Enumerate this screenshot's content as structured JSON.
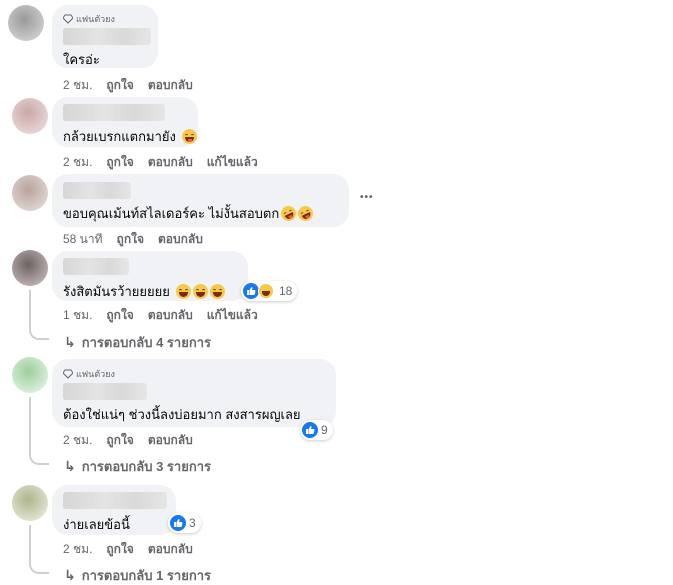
{
  "comments": [
    {
      "badge": "แฟนตัวยง",
      "text": "ใครอ่ะ",
      "meta": {
        "time": "2 ชม.",
        "like": "ถูกใจ",
        "reply": "ตอบกลับ",
        "edited": ""
      },
      "avatar_color": "#b9b9b9"
    },
    {
      "badge": "",
      "text": "กล้วยเบรกแตกมายัง",
      "emojis": [
        "tongue"
      ],
      "meta": {
        "time": "2 ชม.",
        "like": "ถูกใจ",
        "reply": "ตอบกลับ",
        "edited": "แก้ไขแล้ว"
      },
      "avatar_color": "#d9b8b8"
    },
    {
      "badge": "",
      "text": "ขอบคุณเม้นท์สไลเดอร์คะ ไม่งั้นสอบตก",
      "emojis": [
        "rofl",
        "rofl"
      ],
      "meta": {
        "time": "58 นาที",
        "like": "ถูกใจ",
        "reply": "ตอบกลับ",
        "edited": ""
      },
      "more": "•••",
      "avatar_color": "#cdbdb8"
    },
    {
      "badge": "",
      "text": "รังสิตมันรว้ายยยยย",
      "emojis": [
        "grin",
        "grin",
        "grin"
      ],
      "meta": {
        "time": "1 ชม.",
        "like": "ถูกใจ",
        "reply": "ตอบกลับ",
        "edited": "แก้ไขแล้ว"
      },
      "reaction_count": "18",
      "replies_label": "การตอบกลับ 4 รายการ",
      "avatar_color": "#8f8585"
    },
    {
      "badge": "แฟนตัวยง",
      "text": "ต้องใช่แน่ๆ ช่วงนี้ลงบ่อยมาก สงสารผญเลย",
      "meta": {
        "time": "2 ชม.",
        "like": "ถูกใจ",
        "reply": "ตอบกลับ",
        "edited": ""
      },
      "reaction_count": "9",
      "replies_label": "การตอบกลับ 3 รายการ",
      "avatar_color": "#b8d8b8"
    },
    {
      "badge": "",
      "text": "ง่ายเลยข้อนี้",
      "meta": {
        "time": "2 ชม.",
        "like": "ถูกใจ",
        "reply": "ตอบกลับ",
        "edited": ""
      },
      "reaction_count": "3",
      "replies_label": "การตอบกลับ 1 รายการ",
      "avatar_color": "#c8cdb0"
    }
  ],
  "colors": {
    "bubble": "#f0f2f5",
    "meta_text": "#65676b",
    "like_blue": "#1877f2"
  }
}
